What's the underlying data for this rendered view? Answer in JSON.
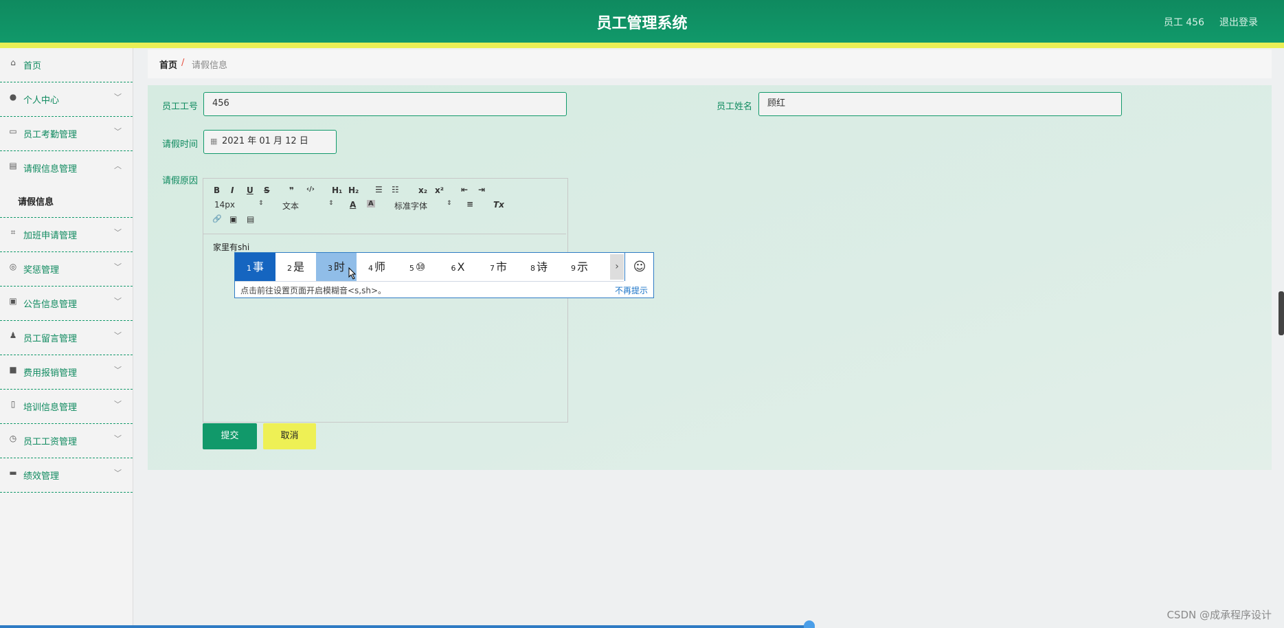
{
  "header": {
    "title": "员工管理系统",
    "user": "员工 456",
    "logout": "退出登录",
    "accent": "#11996a",
    "stripe": "#e9ef55"
  },
  "sidebar": {
    "items": [
      {
        "label": "首页",
        "icon": "home-icon"
      },
      {
        "label": "个人中心",
        "icon": "user-icon"
      },
      {
        "label": "员工考勤管理",
        "icon": "chat-icon"
      },
      {
        "label": "请假信息管理",
        "icon": "clipboard-icon",
        "sub": [
          "请假信息"
        ]
      },
      {
        "label": "加班申请管理",
        "icon": "crop-icon"
      },
      {
        "label": "奖惩管理",
        "icon": "dial-icon"
      },
      {
        "label": "公告信息管理",
        "icon": "notice-icon"
      },
      {
        "label": "员工留言管理",
        "icon": "person-icon"
      },
      {
        "label": "费用报销管理",
        "icon": "message-icon"
      },
      {
        "label": "培训信息管理",
        "icon": "mic-icon"
      },
      {
        "label": "员工工资管理",
        "icon": "clock-icon"
      },
      {
        "label": "绩效管理",
        "icon": "drive-icon"
      }
    ]
  },
  "breadcrumb": {
    "home": "首页",
    "sep": "/",
    "current": "请假信息"
  },
  "form": {
    "emp_id_label": "员工工号",
    "emp_id_value": "456",
    "emp_name_label": "员工姓名",
    "emp_name_value": "顾红",
    "leave_time_label": "请假时间",
    "leave_time_value": "2021 年 01 月 12 日",
    "reason_label": "请假原因",
    "editor_text": "家里有shi",
    "toolbar": {
      "bold": "B",
      "italic": "I",
      "underline": "U",
      "strike": "S",
      "quote": "❞",
      "code": "‹/›",
      "h1": "H₁",
      "h2": "H₂",
      "ol": "☰",
      "ul": "☷",
      "sub": "x₂",
      "sup": "x²",
      "outdent": "⇤",
      "indent": "⇥",
      "size": "14px",
      "format": "文本",
      "font": "标准字体",
      "color": "A",
      "bg": "A",
      "align": "≡",
      "clear": "Tx",
      "link": "🔗",
      "image": "▣",
      "video": "▤"
    },
    "submit": "提交",
    "cancel": "取消"
  },
  "ime": {
    "candidates": [
      {
        "num": "1",
        "text": "事"
      },
      {
        "num": "2",
        "text": "是"
      },
      {
        "num": "3",
        "text": "时"
      },
      {
        "num": "4",
        "text": "师"
      },
      {
        "num": "5",
        "text": "⑩"
      },
      {
        "num": "6",
        "text": "X"
      },
      {
        "num": "7",
        "text": "市"
      },
      {
        "num": "8",
        "text": "诗"
      },
      {
        "num": "9",
        "text": "示"
      }
    ],
    "next": "›",
    "emoji": "☺",
    "tip": "点击前往设置页面开启模糊音<s,sh>。",
    "dismiss": "不再提示"
  },
  "watermark": "CSDN @成承程序设计"
}
